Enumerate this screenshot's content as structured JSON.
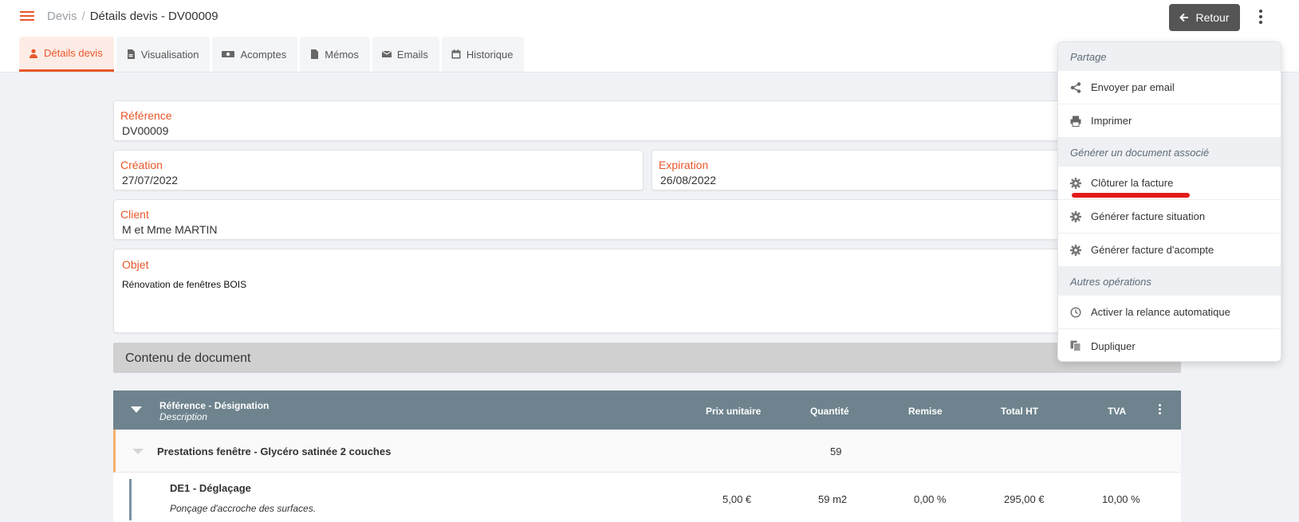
{
  "breadcrumb": {
    "root": "Devis",
    "separator": "/",
    "current": "Détails devis - DV00009"
  },
  "header": {
    "back_label": "Retour"
  },
  "tabs": [
    {
      "label": "Détails devis",
      "icon": "user-icon"
    },
    {
      "label": "Visualisation",
      "icon": "pdf-file-icon"
    },
    {
      "label": "Acomptes",
      "icon": "money-icon"
    },
    {
      "label": "Mémos",
      "icon": "file-icon"
    },
    {
      "label": "Emails",
      "icon": "envelope-icon"
    },
    {
      "label": "Historique",
      "icon": "calendar-icon"
    }
  ],
  "fields": {
    "reference": {
      "label": "Référence",
      "value": "DV00009"
    },
    "creation": {
      "label": "Création",
      "value": "27/07/2022"
    },
    "expiration": {
      "label": "Expiration",
      "value": "26/08/2022"
    },
    "client": {
      "label": "Client",
      "value": "M et Mme MARTIN"
    },
    "objet": {
      "label": "Objet",
      "value": "Rénovation de fenêtres BOIS"
    }
  },
  "content_section": {
    "title": "Contenu de document"
  },
  "table": {
    "headers": {
      "ref": "Référence - Désignation",
      "description": "Description",
      "prix": "Prix unitaire",
      "quantite": "Quantité",
      "remise": "Remise",
      "total": "Total HT",
      "tva": "TVA"
    },
    "group": {
      "title": "Prestations fenêtre - Glycéro satinée 2 couches",
      "quantity": "59"
    },
    "item": {
      "title": "DE1 - Déglaçage",
      "description": "Ponçage d'accroche des surfaces.",
      "prix": "5,00 €",
      "quantite": "59 m2",
      "remise": "0,00 %",
      "total": "295,00 €",
      "tva": "10,00 %"
    }
  },
  "menu": {
    "section_partage": "Partage",
    "envoyer": "Envoyer par email",
    "imprimer": "Imprimer",
    "section_generer": "Générer un document associé",
    "cloturer": "Clôturer la facture",
    "situation": "Générer facture situation",
    "acompte": "Générer facture d'acompte",
    "section_autres": "Autres opérations",
    "relance": "Activer la relance automatique",
    "dupliquer": "Dupliquer"
  },
  "colors": {
    "accent": "#e8572a",
    "back_button": "#555555",
    "table_header": "#6e838e",
    "highlight_underline": "#e31b1b"
  }
}
